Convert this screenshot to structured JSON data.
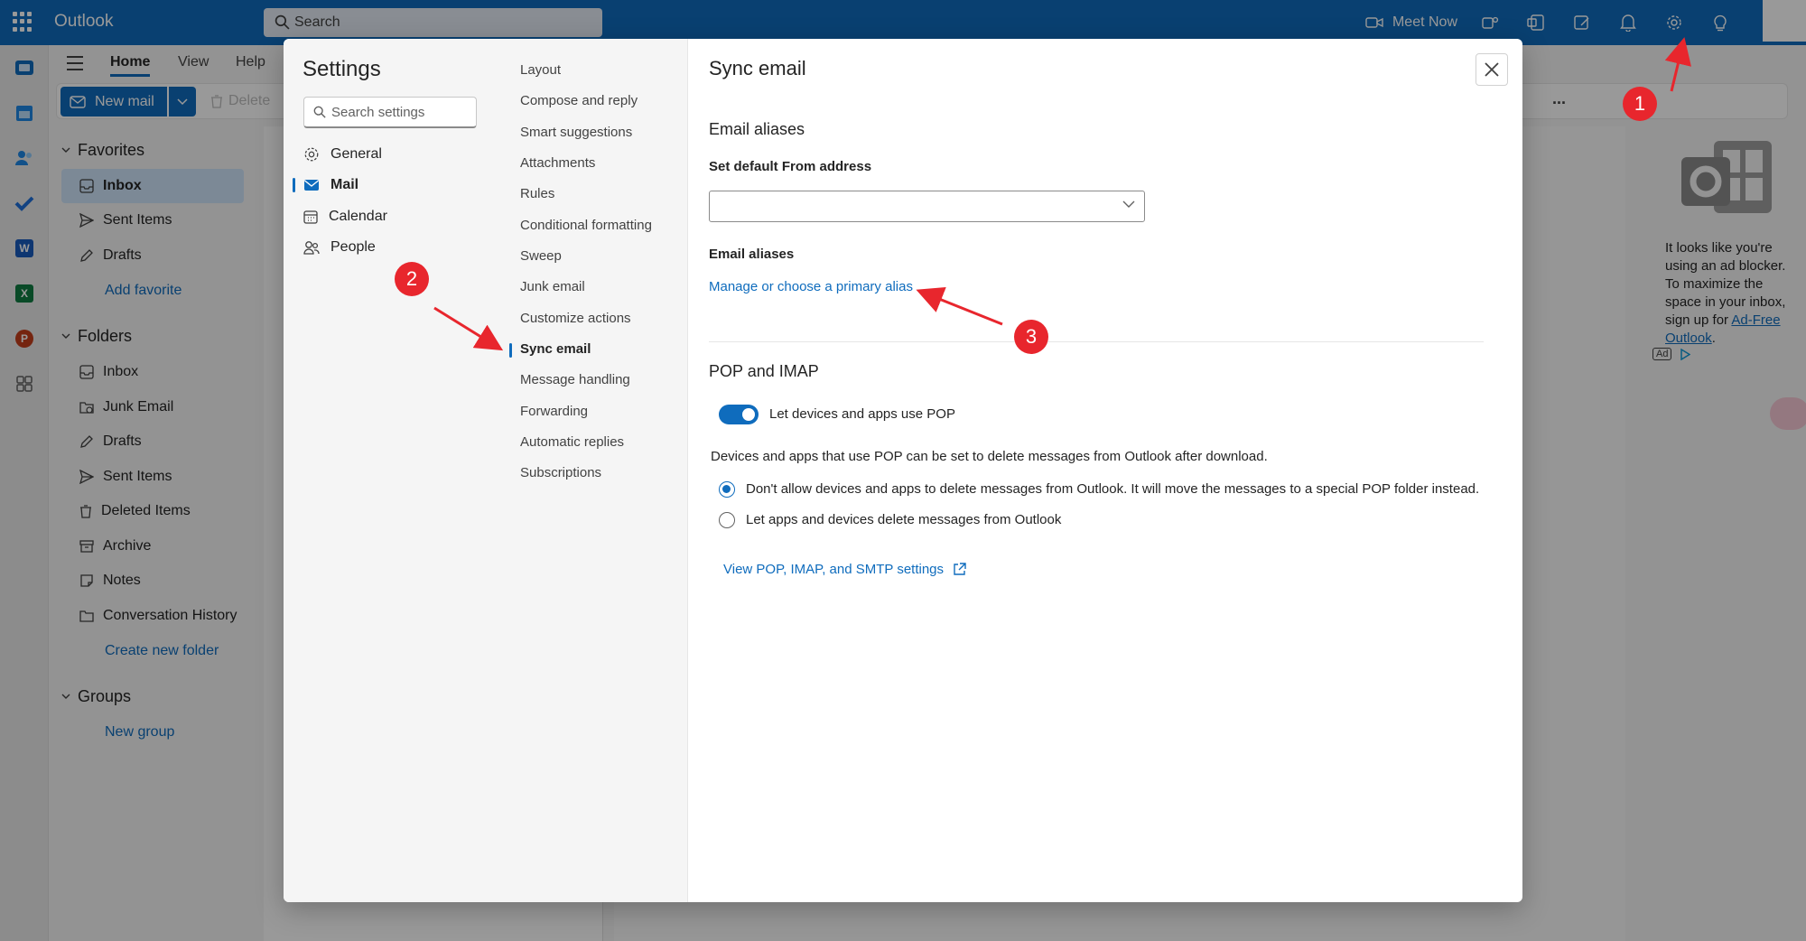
{
  "app": {
    "name": "Outlook"
  },
  "search": {
    "placeholder": "Search"
  },
  "topbar": {
    "meet_now": "Meet Now"
  },
  "ribbon": {
    "tabs": [
      "Home",
      "View",
      "Help"
    ],
    "new_mail": "New mail",
    "delete": "Delete",
    "more": "..."
  },
  "nav": {
    "favorites_header": "Favorites",
    "favorites": [
      "Inbox",
      "Sent Items",
      "Drafts"
    ],
    "add_favorite": "Add favorite",
    "folders_header": "Folders",
    "folders": [
      "Inbox",
      "Junk Email",
      "Drafts",
      "Sent Items",
      "Deleted Items",
      "Archive",
      "Notes",
      "Conversation History"
    ],
    "create_folder": "Create new folder",
    "groups_header": "Groups",
    "new_group": "New group"
  },
  "ad": {
    "text": "It looks like you're using an ad blocker. To maximize the space in your inbox, sign up for",
    "link": "Ad-Free Outlook",
    "badge": "Ad"
  },
  "settings": {
    "title": "Settings",
    "search_placeholder": "Search settings",
    "categories": [
      "General",
      "Mail",
      "Calendar",
      "People"
    ],
    "mail_sections": [
      "Layout",
      "Compose and reply",
      "Smart suggestions",
      "Attachments",
      "Rules",
      "Conditional formatting",
      "Sweep",
      "Junk email",
      "Customize actions",
      "Sync email",
      "Message handling",
      "Forwarding",
      "Automatic replies",
      "Subscriptions"
    ]
  },
  "sync": {
    "title": "Sync email",
    "aliases_header": "Email aliases",
    "default_from_label": "Set default From address",
    "default_from_value": "",
    "aliases_label": "Email aliases",
    "manage_alias_link": "Manage or choose a primary alias",
    "pop_header": "POP and IMAP",
    "pop_toggle_label": "Let devices and apps use POP",
    "pop_toggle_on": true,
    "pop_description": "Devices and apps that use POP can be set to delete messages from Outlook after download.",
    "radio_option_1": "Don't allow devices and apps to delete messages from Outlook. It will move the messages to a special POP folder instead.",
    "radio_option_2": "Let apps and devices delete messages from Outlook",
    "view_settings_link": "View POP, IMAP, and SMTP settings"
  },
  "annotations": [
    "1",
    "2",
    "3"
  ],
  "colors": {
    "accent": "#0f6cbd",
    "annotation": "#e8262d"
  }
}
